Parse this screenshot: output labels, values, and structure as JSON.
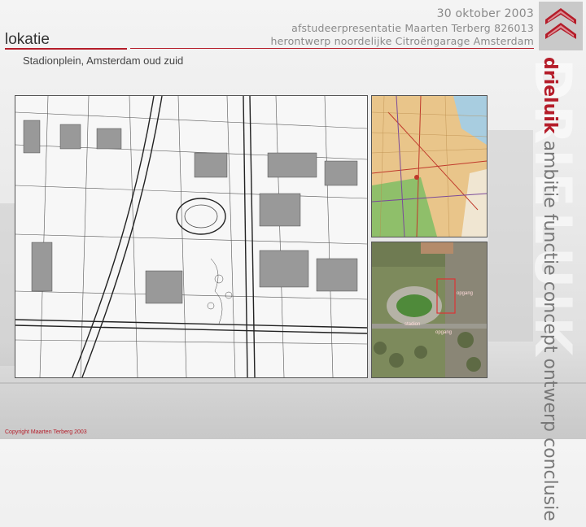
{
  "header": {
    "date": "30 oktober 2003",
    "presentation": "afstudeerpresentatie Maarten Terberg 826013",
    "project": "herontwerp noordelijke Citroëngarage Amsterdam"
  },
  "slide": {
    "title": "lokatie",
    "subtitle": "Stadionplein, Amsterdam oud zuid"
  },
  "side_nav": {
    "active": "drieluik",
    "items": [
      "ambitie",
      "functie",
      "concept",
      "ontwerp",
      "conclusie"
    ],
    "watermark": "DRIELUIK"
  },
  "maps": {
    "main_map": "cadastral-site-plan",
    "city_map": "amsterdam-city-map",
    "aerial": {
      "labels": [
        "opgang",
        "stadion",
        "opgang"
      ]
    }
  },
  "footer": {
    "copyright": "Copyright Maarten Terberg 2003"
  },
  "colors": {
    "accent": "#b51d2a",
    "header_text": "#8a8a8a"
  }
}
